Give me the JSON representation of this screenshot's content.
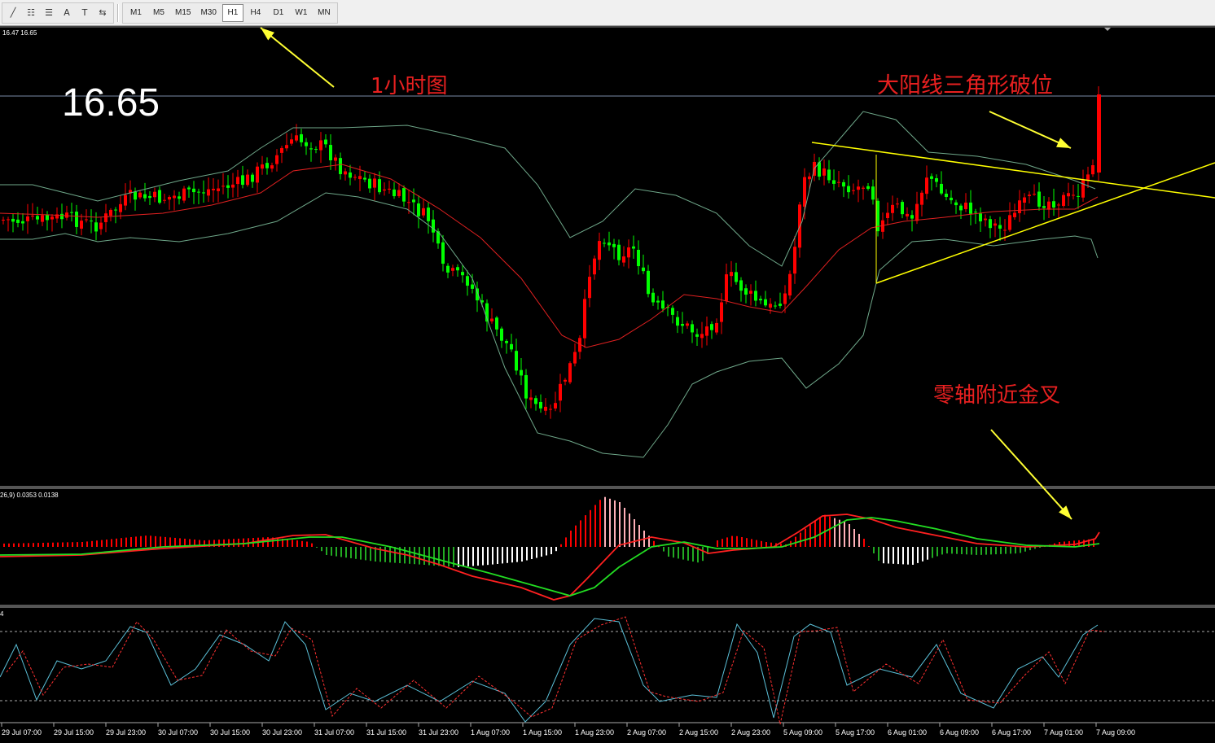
{
  "toolbar": {
    "tools": [
      {
        "name": "line-tool-icon",
        "glyph": "╱"
      },
      {
        "name": "fibonacci-tool-icon",
        "glyph": "☷"
      },
      {
        "name": "fibonacci-fan-icon",
        "glyph": "☰"
      },
      {
        "name": "text-tool-icon",
        "glyph": "A"
      },
      {
        "name": "text-label-tool-icon",
        "glyph": "T"
      },
      {
        "name": "arrows-tool-icon",
        "glyph": "⇆"
      }
    ],
    "timeframes": [
      "M1",
      "M5",
      "M15",
      "M30",
      "H1",
      "H4",
      "D1",
      "W1",
      "MN"
    ],
    "active_timeframe": "H1"
  },
  "chart": {
    "info_line": "16.47 16.65",
    "price_big": "16.65",
    "annotation_timeframe": "1小时图",
    "annotation_breakout": "大阳线三角形破位",
    "annotation_macd": "零轴附近金叉",
    "macd_label": "26,9) 0.0353 0.0138",
    "stoch_label": "4",
    "x_labels": [
      "29 Jul 07:00",
      "29 Jul 15:00",
      "29 Jul 23:00",
      "30 Jul 07:00",
      "30 Jul 15:00",
      "30 Jul 23:00",
      "31 Jul 07:00",
      "31 Jul 15:00",
      "31 Jul 23:00",
      "1 Aug 07:00",
      "1 Aug 15:00",
      "1 Aug 23:00",
      "2 Aug 07:00",
      "2 Aug 15:00",
      "2 Aug 23:00",
      "5 Aug 09:00",
      "5 Aug 17:00",
      "6 Aug 01:00",
      "6 Aug 09:00",
      "6 Aug 17:00",
      "7 Aug 01:00",
      "7 Aug 09:00"
    ],
    "colors": {
      "bull": "#ff0000",
      "bear": "#00ff00",
      "bollinger": "#6fa88a",
      "ma": "#e02020",
      "annotation_text": "#e82020",
      "arrow": "#ffff33",
      "trendline": "#ffff00",
      "macd_line": "#ff2020",
      "signal_line": "#22dd22",
      "stoch_main": "#5bc0d8",
      "stoch_signal": "#ff3030"
    }
  }
}
